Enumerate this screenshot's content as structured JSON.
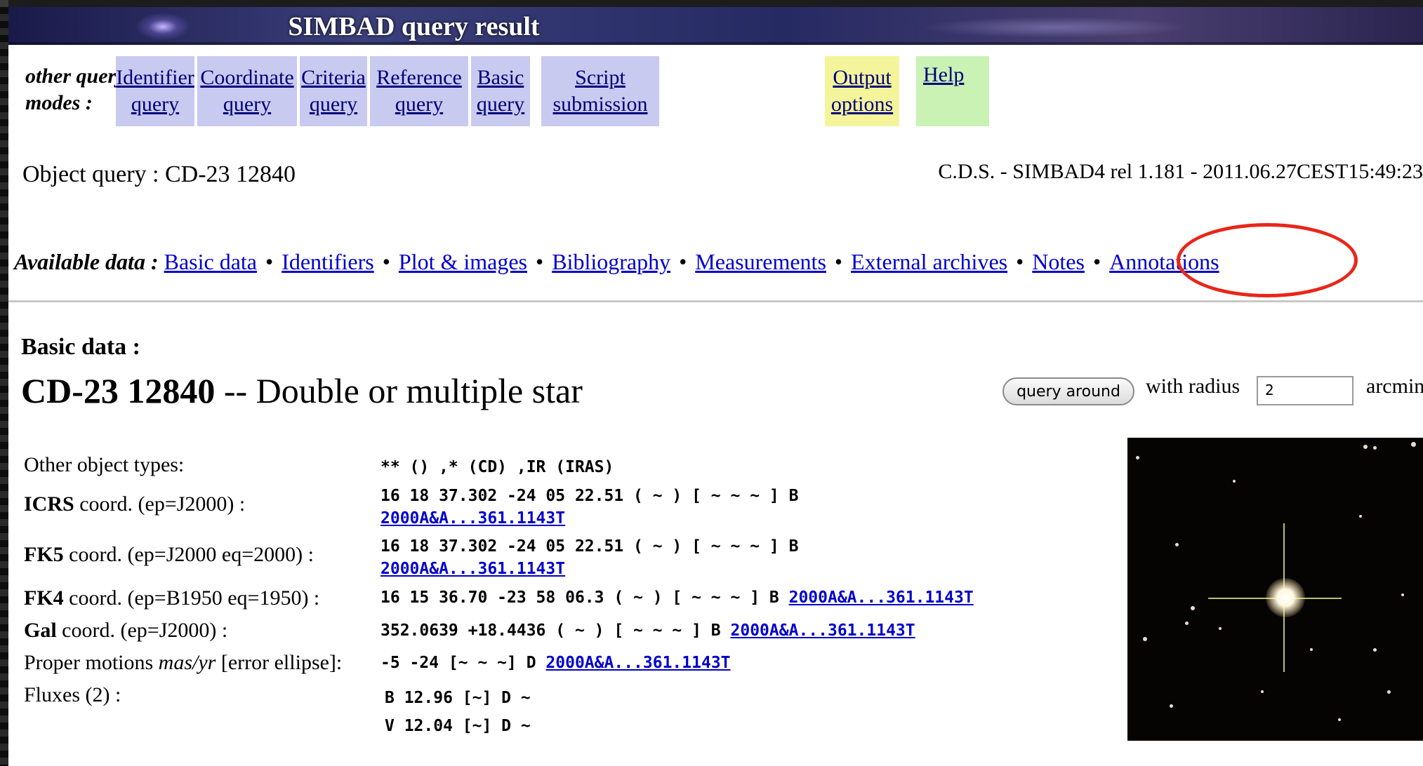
{
  "banner": {
    "title": "SIMBAD query result"
  },
  "query_modes": {
    "label": "other query modes :",
    "tabs": [
      {
        "line1": "Identifier",
        "line2": "query",
        "color": "#c9caf0"
      },
      {
        "line1": "Coordinate",
        "line2": "query",
        "color": "#c9caf0"
      },
      {
        "line1": "Criteria",
        "line2": "query",
        "color": "#c9caf0"
      },
      {
        "line1": "Reference",
        "line2": "query",
        "color": "#c9caf0"
      },
      {
        "line1": "Basic",
        "line2": "query",
        "color": "#c9caf0"
      },
      {
        "line1": "Script",
        "line2": "submission",
        "color": "#c9caf0"
      },
      {
        "line1": "Output",
        "line2": "options",
        "color": "#f4f59a"
      },
      {
        "line1": "Help",
        "line2": "",
        "color": "#c9f2b4"
      }
    ]
  },
  "header": {
    "object_query": "Object query : CD-23 12840",
    "release": "C.D.S. - SIMBAD4 rel 1.181 - 2011.06.27CEST15:49:23"
  },
  "available": {
    "label": "Available data :",
    "links": [
      "Basic data",
      "Identifiers",
      "Plot & images",
      "Bibliography",
      "Measurements",
      "External archives",
      "Notes",
      "Annotations"
    ],
    "separator": "•",
    "highlight_color": "#e8261a"
  },
  "basic": {
    "heading": "Basic data :",
    "object_id": "CD-23 12840",
    "object_type": " -- Double or multiple star",
    "query_around_label": "query around",
    "radius_label": "with radius",
    "radius_value": "2",
    "radius_unit": "arcmin"
  },
  "rows": {
    "other_types": {
      "label": "Other object types:",
      "value": "** () ,* (CD) ,IR (IRAS)"
    },
    "icrs": {
      "label_bold": "ICRS",
      "label_rest": " coord. (ep=J2000) :",
      "value": "16 18 37.302 -24 05 22.51 ( ~ ) [ ~ ~ ~ ] B",
      "ref": "2000A&A...361.1143T"
    },
    "fk5": {
      "label_bold": "FK5",
      "label_rest": " coord. (ep=J2000 eq=2000) :",
      "value": "16 18 37.302 -24 05 22.51 ( ~ ) [ ~ ~ ~ ] B",
      "ref": "2000A&A...361.1143T"
    },
    "fk4": {
      "label_bold": "FK4",
      "label_rest": " coord. (ep=B1950 eq=1950) :",
      "value": "16 15 36.70 -23 58 06.3 ( ~ ) [ ~ ~ ~ ] B",
      "ref": "2000A&A...361.1143T"
    },
    "gal": {
      "label_bold": "Gal",
      "label_rest": " coord. (ep=J2000) :",
      "value": "352.0639 +18.4436 ( ~ ) [ ~ ~ ~ ] B",
      "ref": "2000A&A...361.1143T"
    },
    "pm": {
      "label_pre": "Proper motions ",
      "label_italic": "mas/yr",
      "label_post": " [error ellipse]:",
      "value": "-5 -24 [~ ~ ~] D",
      "ref": "2000A&A...361.1143T"
    },
    "fluxes": {
      "label": "Fluxes (2) :",
      "values": [
        "B 12.96 [~] D ~",
        "V 12.04 [~] D ~"
      ]
    }
  },
  "image": {
    "description_icon": "star-field-thumbnail"
  }
}
